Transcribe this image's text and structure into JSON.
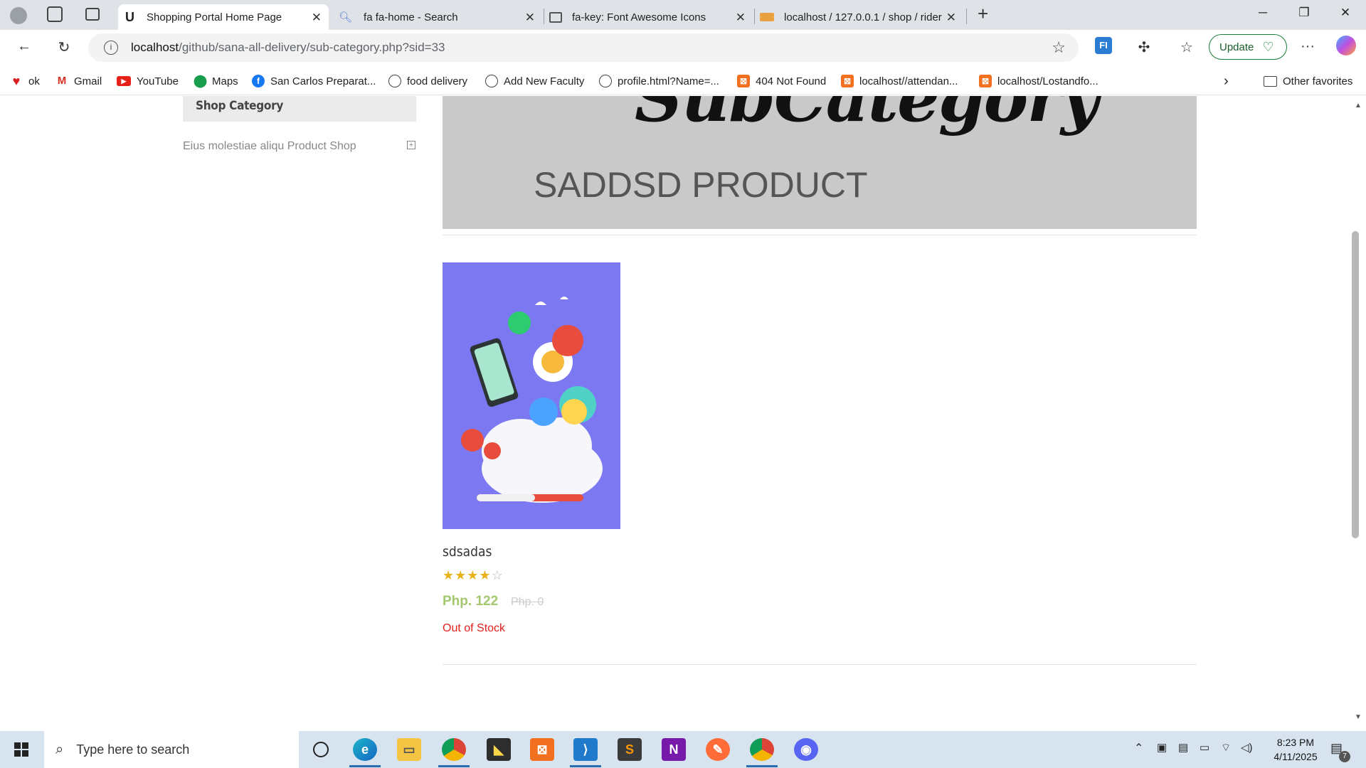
{
  "browser": {
    "tabs": [
      {
        "title": "Shopping Portal Home Page",
        "active": true
      },
      {
        "title": "fa fa-home - Search",
        "active": false
      },
      {
        "title": "fa-key: Font Awesome Icons",
        "active": false
      },
      {
        "title": "localhost / 127.0.0.1 / shop / rider",
        "active": false
      }
    ],
    "address": {
      "host": "localhost",
      "path": "/github/sana-all-delivery/sub-category.php?sid=33"
    },
    "update_label": "Update",
    "bookmarks": [
      {
        "label": "ok",
        "icon": "heart-icon"
      },
      {
        "label": "Gmail",
        "icon": "gmail-icon"
      },
      {
        "label": "YouTube",
        "icon": "youtube-icon"
      },
      {
        "label": "Maps",
        "icon": "maps-icon"
      },
      {
        "label": "San Carlos Preparat...",
        "icon": "facebook-icon"
      },
      {
        "label": "food delivery",
        "icon": "globe-icon"
      },
      {
        "label": "Add New Faculty",
        "icon": "globe-icon"
      },
      {
        "label": "profile.html?Name=...",
        "icon": "globe-icon"
      },
      {
        "label": "404 Not Found",
        "icon": "xampp-icon"
      },
      {
        "label": "localhost//attendan...",
        "icon": "xampp-icon"
      },
      {
        "label": "localhost/Lostandfo...",
        "icon": "xampp-icon"
      }
    ],
    "other_favorites": "Other favorites"
  },
  "page": {
    "sidebar": {
      "heading": "Shop Category",
      "items": [
        {
          "label": "Eius molestiae aliqu Product Shop"
        }
      ]
    },
    "banner": {
      "script_heading": "SubCategory",
      "title": "SADDSD PRODUCT"
    },
    "product": {
      "name": "sdsadas",
      "rating": 4,
      "rating_max": 5,
      "price": "Php. 122",
      "old_price": "Php. 0",
      "stock_status": "Out of Stock"
    }
  },
  "taskbar": {
    "search_placeholder": "Type here to search",
    "time": "8:23 PM",
    "date": "4/11/2025",
    "notification_count": "7"
  }
}
